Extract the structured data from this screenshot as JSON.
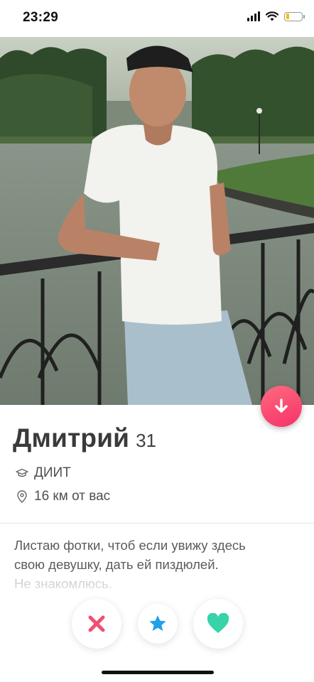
{
  "status_bar": {
    "time": "23:29",
    "battery_level": 0.2,
    "battery_color": "#f2c200"
  },
  "profile": {
    "name": "Дмитрий",
    "age": "31",
    "school": "ДИИТ",
    "distance": "16 км от вас",
    "bio_line1": "Листаю фотки, чтоб если увижу здесь",
    "bio_line2": "свою девушку, дать ей пиздюлей.",
    "bio_line3": "Не знакомлюсь."
  },
  "icons": {
    "school": "graduation-cap-icon",
    "location": "location-pin-icon",
    "info_toggle": "arrow-down-icon",
    "nope": "close-icon",
    "super_like": "star-icon",
    "like": "heart-icon"
  },
  "colors": {
    "accent": "#f5326a",
    "nope": "#f0506e",
    "super_like": "#21a1e8",
    "like": "#36d4a8"
  }
}
